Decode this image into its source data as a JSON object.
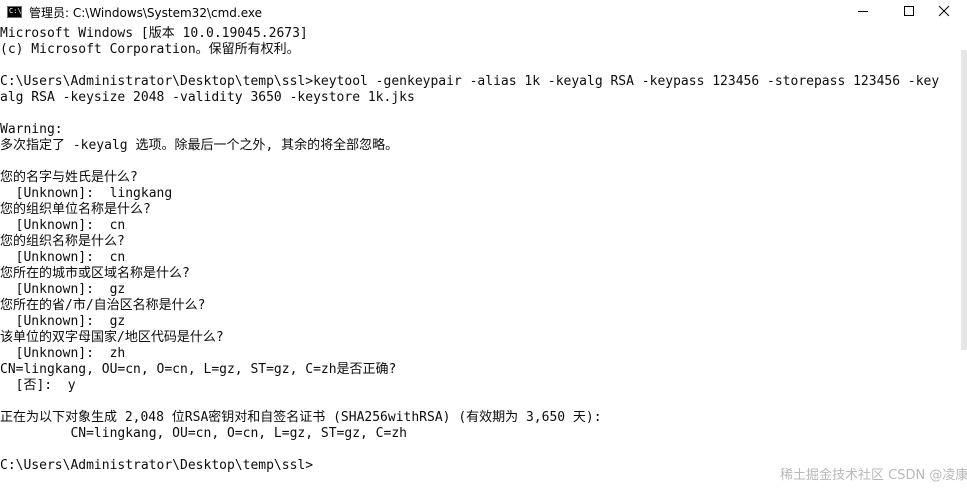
{
  "window": {
    "title": "管理员: C:\\Windows\\System32\\cmd.exe",
    "icon_name": "cmd-icon",
    "icon_text": "C:\\",
    "minimize_icon": "minimize-icon",
    "maximize_icon": "maximize-icon",
    "close_icon": "close-icon"
  },
  "console": {
    "lines": [
      "Microsoft Windows [版本 10.0.19045.2673]",
      "(c) Microsoft Corporation。保留所有权利。",
      "",
      "C:\\Users\\Administrator\\Desktop\\temp\\ssl>keytool -genkeypair -alias 1k -keyalg RSA -keypass 123456 -storepass 123456 -key",
      "alg RSA -keysize 2048 -validity 3650 -keystore 1k.jks",
      "",
      "Warning:",
      "多次指定了 -keyalg 选项。除最后一个之外, 其余的将全部忽略。",
      "",
      "您的名字与姓氏是什么?",
      "  [Unknown]:  lingkang",
      "您的组织单位名称是什么?",
      "  [Unknown]:  cn",
      "您的组织名称是什么?",
      "  [Unknown]:  cn",
      "您所在的城市或区域名称是什么?",
      "  [Unknown]:  gz",
      "您所在的省/市/自治区名称是什么?",
      "  [Unknown]:  gz",
      "该单位的双字母国家/地区代码是什么?",
      "  [Unknown]:  zh",
      "CN=lingkang, OU=cn, O=cn, L=gz, ST=gz, C=zh是否正确?",
      "  [否]:  y",
      "",
      "正在为以下对象生成 2,048 位RSA密钥对和自签名证书 (SHA256withRSA) (有效期为 3,650 天):",
      "         CN=lingkang, OU=cn, O=cn, L=gz, ST=gz, C=zh",
      "",
      "C:\\Users\\Administrator\\Desktop\\temp\\ssl>"
    ]
  },
  "watermark": "稀土掘金技术社区 CSDN @凌康ACG",
  "colors": {
    "background": "#ffffff",
    "text": "#0c0c0c",
    "watermark": "#b9b9b9"
  }
}
